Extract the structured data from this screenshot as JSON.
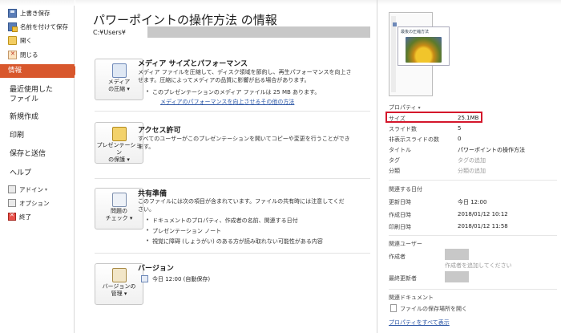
{
  "nav": {
    "save": "上書き保存",
    "save_as": "名前を付けて保存",
    "open": "開く",
    "close": "閉じる",
    "info": "情報",
    "recent_line1": "最近使用した",
    "recent_line2": "ファイル",
    "new": "新規作成",
    "print": "印刷",
    "save_send": "保存と送信",
    "help": "ヘルプ",
    "addins": "アドイン",
    "options": "オプション",
    "exit": "終了"
  },
  "main": {
    "title": "パワーポイントの操作方法 の情報",
    "path": "C:¥Users¥",
    "media": {
      "button_line1": "メディア",
      "button_line2": "の圧縮 ▾",
      "heading": "メディア サイズとパフォーマンス",
      "text_line1": "メディア ファイルを圧縮して、ディスク領域を節約し、再生パフォーマンスを向上さ",
      "text_line2": "せます。圧縮によってメディアの品質に影響が出る場合があります。",
      "bullet": "このプレゼンテーションのメディア ファイルは 25 MB あります。",
      "link": "メディアのパフォーマンスを向上させるその他の方法"
    },
    "permissions": {
      "button_line1": "プレゼンテーション",
      "button_line2": "の保護 ▾",
      "heading": "アクセス許可",
      "text_line1": "すべてのユーザーがこのプレゼンテーションを開いてコピーや変更を行うことができ",
      "text_line2": "ます。"
    },
    "prepare": {
      "button_line1": "問題の",
      "button_line2": "チェック ▾",
      "heading": "共有準備",
      "text_line1": "このファイルには次の項目が含まれています。ファイルの共有時には注意してくだ",
      "text_line2": "さい。",
      "bullets": [
        "ドキュメントのプロパティ、作成者の名前、関連する日付",
        "プレゼンテーション ノート",
        "視覚に障碍 (しょうがい) のある方が読み取れない可能性がある内容"
      ]
    },
    "versions": {
      "button_line1": "バージョンの",
      "button_line2": "管理 ▾",
      "heading": "バージョン",
      "entry": "今日 12:00 (自動保存)"
    }
  },
  "side": {
    "slide_title": "最後の圧縮方法",
    "properties_label": "プロパティ",
    "props": [
      {
        "k": "サイズ",
        "v": "25.1MB"
      },
      {
        "k": "スライド数",
        "v": "5"
      },
      {
        "k": "非表示スライドの数",
        "v": "0"
      },
      {
        "k": "タイトル",
        "v": "パワーポイントの操作方法"
      },
      {
        "k": "タグ",
        "v": "タグの追加"
      },
      {
        "k": "分類",
        "v": "分類の追加"
      }
    ],
    "dates_label": "関連する日付",
    "dates": [
      {
        "k": "更新日時",
        "v": "今日 12:00"
      },
      {
        "k": "作成日時",
        "v": "2018/01/12 10:12"
      },
      {
        "k": "印刷日時",
        "v": "2018/01/12 11:58"
      }
    ],
    "people_label": "関連ユーザー",
    "author_label": "作成者",
    "add_author": "作成者を追加してください",
    "last_modified_label": "最終更新者",
    "docs_label": "関連ドキュメント",
    "open_location": "ファイルの保存場所を開く",
    "show_all": "プロパティをすべて表示"
  }
}
